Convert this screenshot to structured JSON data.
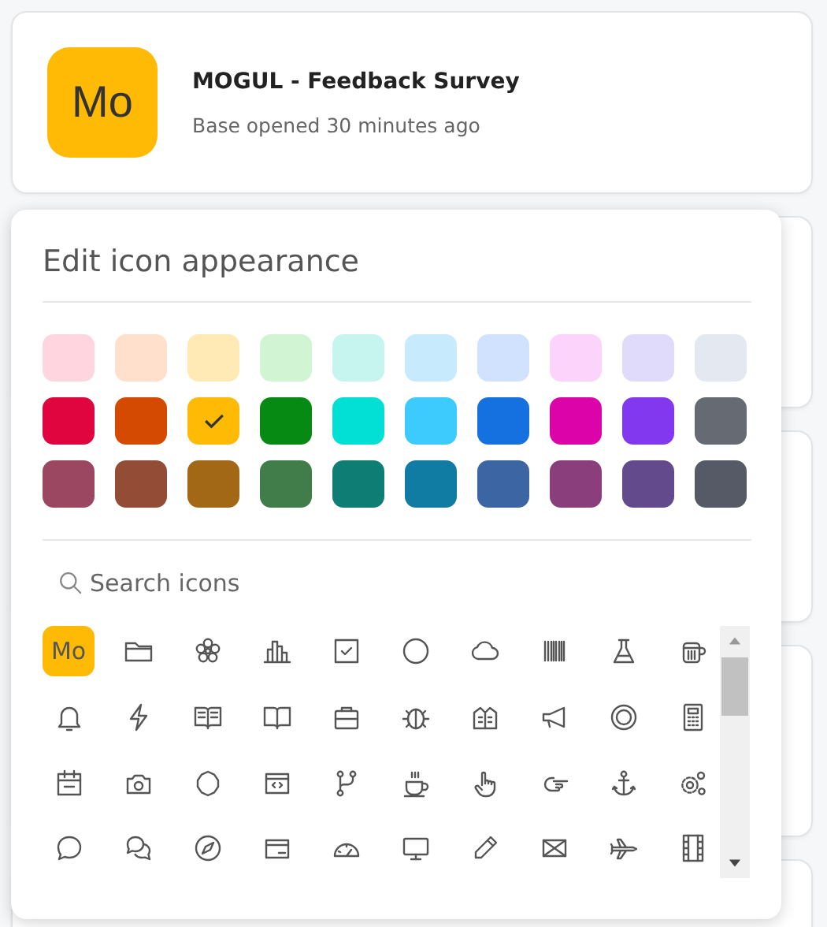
{
  "base_card": {
    "icon_text": "Mo",
    "title": "MOGUL - Feedback Survey",
    "subtitle": "Base opened 30 minutes ago"
  },
  "popover": {
    "title": "Edit icon appearance",
    "colors": [
      {
        "color": "#ffd6e0",
        "selected": false
      },
      {
        "color": "#ffe0cc",
        "selected": false
      },
      {
        "color": "#ffeab5",
        "selected": false
      },
      {
        "color": "#d1f5d3",
        "selected": false
      },
      {
        "color": "#c5f5ee",
        "selected": false
      },
      {
        "color": "#c7ebfc",
        "selected": false
      },
      {
        "color": "#d1e2fe",
        "selected": false
      },
      {
        "color": "#fcd4fb",
        "selected": false
      },
      {
        "color": "#e0dbfb",
        "selected": false
      },
      {
        "color": "#e4e8f1",
        "selected": false
      },
      {
        "color": "#e0053e",
        "selected": false
      },
      {
        "color": "#d44a02",
        "selected": false
      },
      {
        "color": "#ffba05",
        "selected": true
      },
      {
        "color": "#078a14",
        "selected": false
      },
      {
        "color": "#02dfd4",
        "selected": false
      },
      {
        "color": "#3dcbfd",
        "selected": false
      },
      {
        "color": "#1570e0",
        "selected": false
      },
      {
        "color": "#dc04a9",
        "selected": false
      },
      {
        "color": "#8138ef",
        "selected": false
      },
      {
        "color": "#666b73",
        "selected": false
      },
      {
        "color": "#9c4761",
        "selected": false
      },
      {
        "color": "#934d36",
        "selected": false
      },
      {
        "color": "#a36815",
        "selected": false
      },
      {
        "color": "#417d4b",
        "selected": false
      },
      {
        "color": "#0e7d74",
        "selected": false
      },
      {
        "color": "#107ba3",
        "selected": false
      },
      {
        "color": "#3c65a3",
        "selected": false
      },
      {
        "color": "#8b3e7c",
        "selected": false
      },
      {
        "color": "#634a8d",
        "selected": false
      },
      {
        "color": "#565a66",
        "selected": false
      }
    ],
    "search": {
      "placeholder": "Search icons"
    },
    "icons": [
      {
        "kind": "initials",
        "label": "Mo",
        "selected": true
      },
      {
        "kind": "glyph",
        "selected": false
      },
      {
        "kind": "glyph",
        "selected": false
      },
      {
        "kind": "glyph",
        "selected": false
      },
      {
        "kind": "glyph",
        "selected": false
      },
      {
        "kind": "glyph",
        "selected": false
      },
      {
        "kind": "glyph",
        "selected": false
      },
      {
        "kind": "glyph",
        "selected": false
      },
      {
        "kind": "glyph",
        "selected": false
      },
      {
        "kind": "glyph",
        "selected": false
      },
      {
        "kind": "glyph",
        "selected": false
      },
      {
        "kind": "glyph",
        "selected": false
      },
      {
        "kind": "glyph",
        "selected": false
      },
      {
        "kind": "glyph",
        "selected": false
      },
      {
        "kind": "glyph",
        "selected": false
      },
      {
        "kind": "glyph",
        "selected": false
      },
      {
        "kind": "glyph",
        "selected": false
      },
      {
        "kind": "glyph",
        "selected": false
      },
      {
        "kind": "glyph",
        "selected": false
      },
      {
        "kind": "glyph",
        "selected": false
      },
      {
        "kind": "glyph",
        "selected": false
      },
      {
        "kind": "glyph",
        "selected": false
      },
      {
        "kind": "glyph",
        "selected": false
      },
      {
        "kind": "glyph",
        "selected": false
      },
      {
        "kind": "glyph",
        "selected": false
      },
      {
        "kind": "glyph",
        "selected": false
      },
      {
        "kind": "glyph",
        "selected": false
      },
      {
        "kind": "glyph",
        "selected": false
      },
      {
        "kind": "glyph",
        "selected": false
      },
      {
        "kind": "glyph",
        "selected": false
      },
      {
        "kind": "glyph",
        "selected": false
      },
      {
        "kind": "glyph",
        "selected": false
      },
      {
        "kind": "glyph",
        "selected": false
      },
      {
        "kind": "glyph",
        "selected": false
      },
      {
        "kind": "glyph",
        "selected": false
      },
      {
        "kind": "glyph",
        "selected": false
      },
      {
        "kind": "glyph",
        "selected": false
      },
      {
        "kind": "glyph",
        "selected": false
      },
      {
        "kind": "glyph",
        "selected": false
      },
      {
        "kind": "glyph",
        "selected": false
      }
    ]
  }
}
